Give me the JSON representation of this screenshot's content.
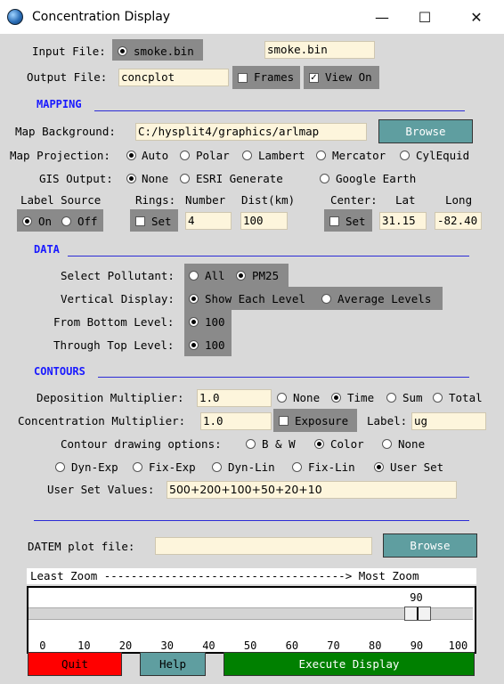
{
  "window": {
    "title": "Concentration Display",
    "minimize": "—",
    "maximize": "☐",
    "close": "✕"
  },
  "input_file": {
    "label": "Input File:",
    "radio_label": "smoke.bin",
    "value": "smoke.bin"
  },
  "output_file": {
    "label": "Output File:",
    "value": "concplot",
    "frames_label": "Frames",
    "view_on_label": "View On"
  },
  "mapping": {
    "header": "MAPPING",
    "background_label": "Map Background:",
    "background_value": "C:/hysplit4/graphics/arlmap",
    "browse_label": "Browse",
    "projection_label": "Map Projection:",
    "projections": [
      "Auto",
      "Polar",
      "Lambert",
      "Mercator",
      "CylEquid"
    ],
    "gis_label": "GIS Output:",
    "gis_options": [
      "None",
      "ESRI Generate",
      "Google Earth"
    ],
    "label_source": {
      "title": "Label Source",
      "on": "On",
      "off": "Off"
    },
    "rings": {
      "title": "Rings:",
      "set": "Set",
      "number_label": "Number",
      "number_value": "4",
      "dist_label": "Dist(km)",
      "dist_value": "100"
    },
    "center": {
      "title": "Center:",
      "set": "Set",
      "lat_label": "Lat",
      "lat_value": "31.15",
      "long_label": "Long",
      "long_value": "-82.40"
    }
  },
  "data": {
    "header": "DATA",
    "pollutant_label": "Select Pollutant:",
    "pollutant_options": [
      "All",
      "PM25"
    ],
    "vertical_label": "Vertical Display:",
    "vertical_options": [
      "Show Each Level",
      "Average Levels"
    ],
    "bottom_label": "From Bottom Level:",
    "bottom_value": "100",
    "top_label": "Through Top Level:",
    "top_value": "100"
  },
  "contours": {
    "header": "CONTOURS",
    "deposition_label": "Deposition Multiplier:",
    "deposition_value": "1.0",
    "deposition_options": [
      "None",
      "Time",
      "Sum",
      "Total"
    ],
    "concentration_label": "Concentration Multiplier:",
    "concentration_value": "1.0",
    "exposure_label": "Exposure",
    "label_label": "Label:",
    "label_value": "ug",
    "drawing_label": "Contour drawing options:",
    "drawing_options": [
      "B & W",
      "Color",
      "None"
    ],
    "scale_options": [
      "Dyn-Exp",
      "Fix-Exp",
      "Dyn-Lin",
      "Fix-Lin",
      "User Set"
    ],
    "user_set_label": "User Set Values:",
    "user_set_value": "500+200+100+50+20+10"
  },
  "datem": {
    "label": "DATEM plot file:",
    "value": "",
    "browse_label": "Browse"
  },
  "zoom": {
    "caption": "Least Zoom ------------------------------------> Most Zoom",
    "value": "90",
    "level": 90,
    "ticks": [
      "0",
      "10",
      "20",
      "30",
      "40",
      "50",
      "60",
      "70",
      "80",
      "90",
      "100"
    ]
  },
  "buttons": {
    "quit": "Quit",
    "help": "Help",
    "execute": "Execute Display"
  },
  "colors": {
    "quit": "#ff0000",
    "help": "#5f9ea0",
    "execute": "#008000",
    "header": "#1a1aff",
    "entry": "#fdf5dc"
  }
}
